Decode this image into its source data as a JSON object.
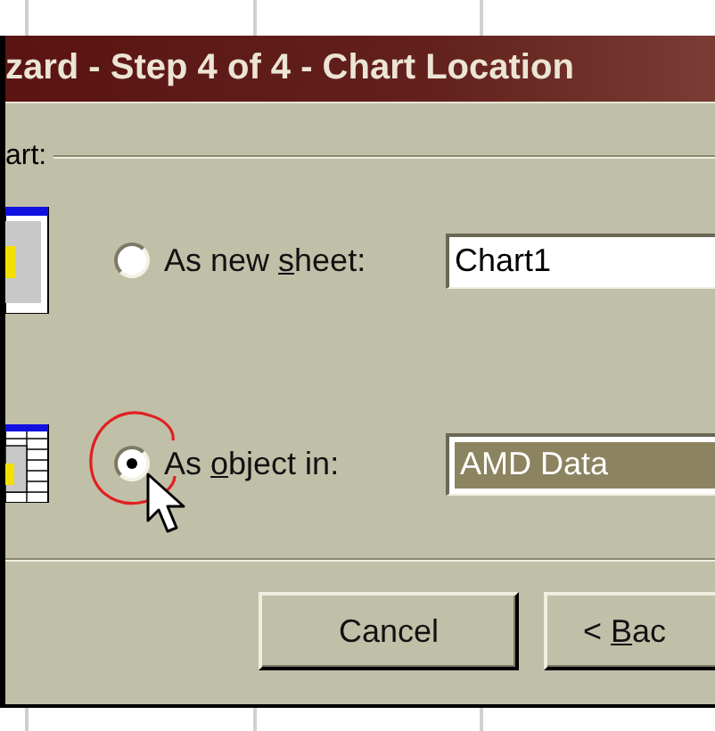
{
  "window": {
    "title": "zard - Step 4 of 4 - Chart Location"
  },
  "group_label": "art:",
  "options": [
    {
      "kind": "new_sheet",
      "label_before": "As new ",
      "mnemonic": "s",
      "label_after": "heet:",
      "selected": false,
      "value": "Chart1"
    },
    {
      "kind": "object",
      "label_before": "As ",
      "mnemonic": "o",
      "label_after": "bject in:",
      "selected": true,
      "value": "AMD Data"
    }
  ],
  "buttons": [
    {
      "label_after": "Cancel"
    },
    {
      "label_before": "< ",
      "mnemonic": "B",
      "label_after": "ac"
    }
  ]
}
